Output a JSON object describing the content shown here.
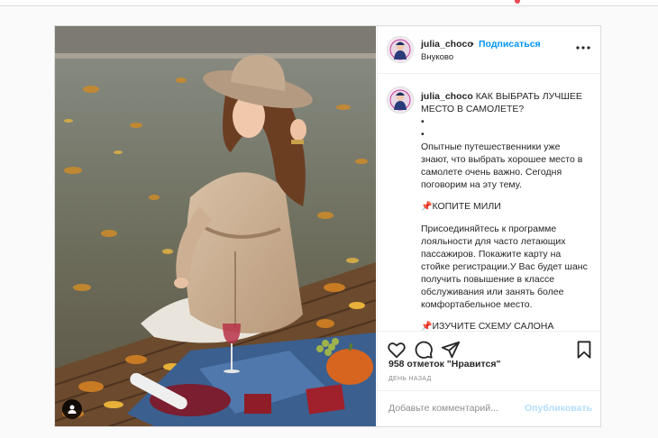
{
  "post": {
    "author": {
      "username": "julia_choco",
      "follow_label": "Подписаться",
      "separator": "•",
      "location": "Внуково"
    },
    "caption": {
      "username": "julia_choco",
      "title": "КАК ВЫБРАТЬ ЛУЧШЕЕ МЕСТО В САМОЛЕТЕ?",
      "bullet_1": "•",
      "bullet_2": "•",
      "paragraph_1": "Опытные путешественники уже знают, что выбрать хорошее место в самолете очень важно. Сегодня поговорим на эту тему.",
      "heading_1": "КОПИТЕ МИЛИ",
      "paragraph_2": "Присоединяйтесь к программе лояльности для часто летающих пассажиров. Покажите карту на стойке регистрации.У Вас будет шанс получить повышение в классе обслуживания или занять более комфортабельное место.",
      "heading_2": "ИЗУЧИТЕ СХЕМУ САЛОНА",
      "pin_glyph": "📌"
    },
    "likes_text": "958 отметок \"Нравится\"",
    "time_text": "ДЕНЬ НАЗАД",
    "comment": {
      "placeholder": "Добавьте комментарий...",
      "publish_label": "Опубликовать"
    },
    "icons": {
      "like": "heart-icon",
      "comment": "comment-icon",
      "share": "share-icon",
      "save": "bookmark-icon",
      "more": "more-icon",
      "user_tag": "user-tag-icon"
    },
    "colors": {
      "accent": "#0095f6",
      "publish_disabled": "#b2dffc",
      "text": "#262626",
      "secondary": "#8e8e8e",
      "notification": "#ed4956"
    }
  }
}
